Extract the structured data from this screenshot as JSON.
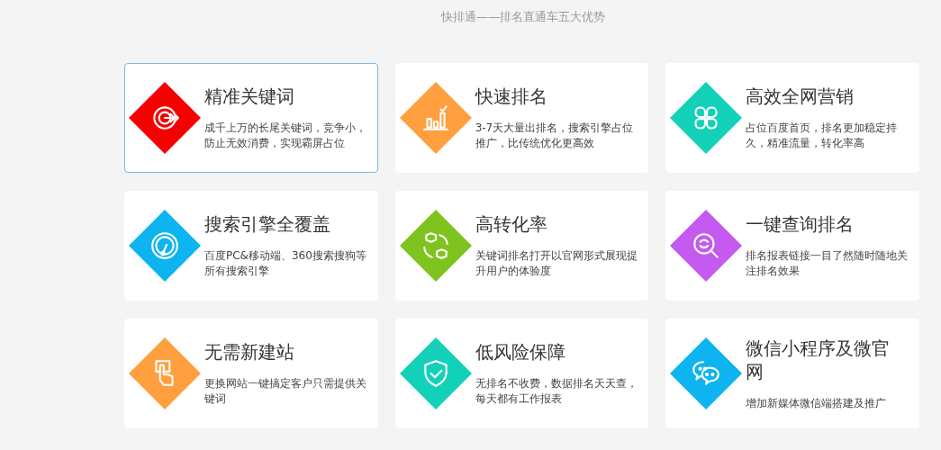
{
  "heading": "快排通——排名直通车五大优势",
  "cards": [
    {
      "title": "精准关键词",
      "description": "成千上万的长尾关键词，竞争小，防止无效消费，实现霸屏占位",
      "color": "#f50000",
      "selected": true
    },
    {
      "title": "快速排名",
      "description": "3-7天大量出排名，搜索引擎占位推广，比传统优化更高效",
      "color": "#ff9f3e",
      "selected": false
    },
    {
      "title": "高效全网营销",
      "description": "占位百度首页，排名更加稳定持久，精准流量，转化率高",
      "color": "#13d1b8",
      "selected": false
    },
    {
      "title": "搜索引擎全覆盖",
      "description": "百度PC&移动端、360搜索搜狗等所有搜索引擎",
      "color": "#0db4ef",
      "selected": false
    },
    {
      "title": "高转化率",
      "description": "关键词排名打开以官网形式展现提升用户的体验度",
      "color": "#7fc31f",
      "selected": false
    },
    {
      "title": "一键查询排名",
      "description": "排名报表链接一目了然随时随地关注排名效果",
      "color": "#c45af0",
      "selected": false
    },
    {
      "title": "无需新建站",
      "description": "更换网站一键搞定客户只需提供关键词",
      "color": "#ff9f3e",
      "selected": false
    },
    {
      "title": "低风险保障",
      "description": "无排名不收费，数据排名天天查，每天都有工作报表",
      "color": "#13d1b8",
      "selected": false
    },
    {
      "title": "微信小程序及微官网",
      "description": "增加新媒体微信端搭建及推广",
      "color": "#0db4ef",
      "selected": false
    }
  ]
}
